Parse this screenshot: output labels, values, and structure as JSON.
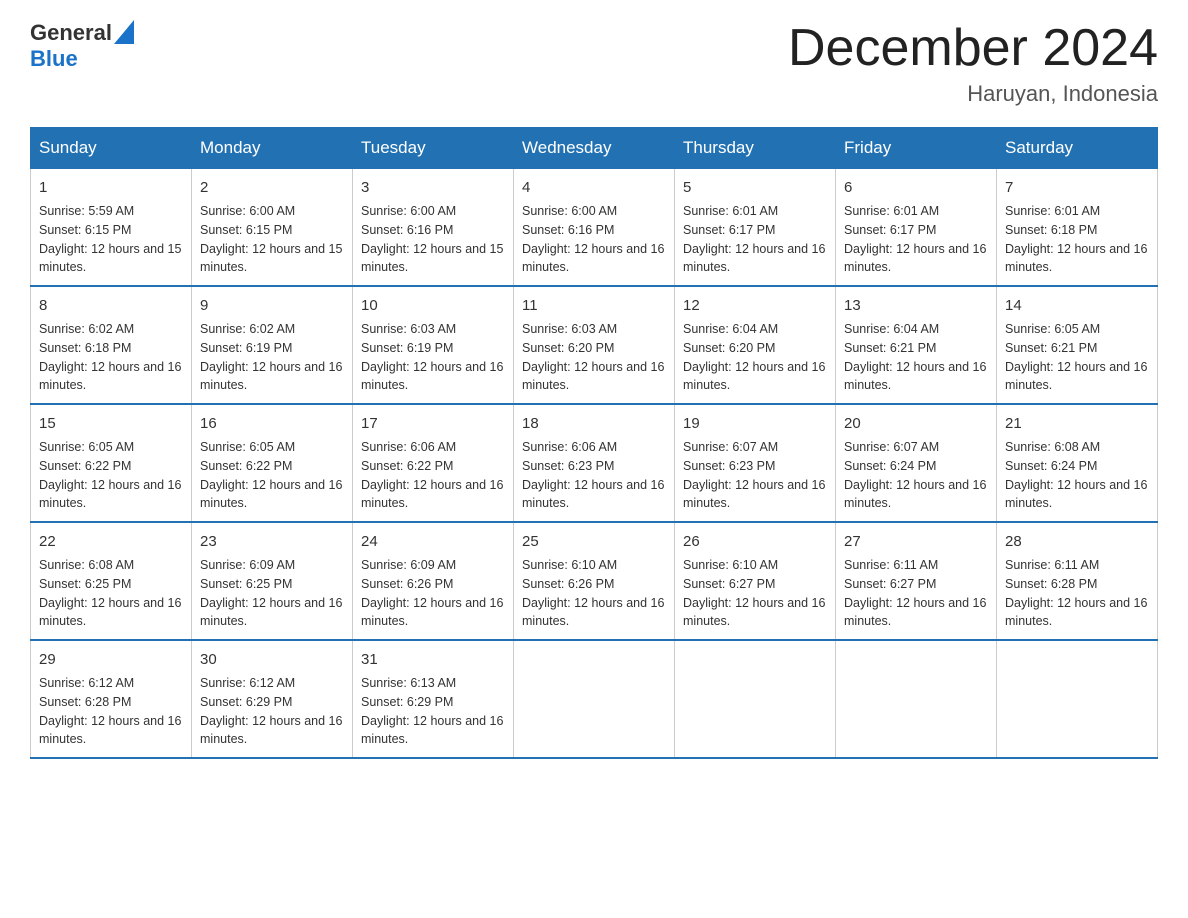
{
  "header": {
    "logo_general": "General",
    "logo_blue": "Blue",
    "title": "December 2024",
    "subtitle": "Haruyan, Indonesia"
  },
  "days_of_week": [
    "Sunday",
    "Monday",
    "Tuesday",
    "Wednesday",
    "Thursday",
    "Friday",
    "Saturday"
  ],
  "weeks": [
    [
      {
        "day": "1",
        "sunrise": "5:59 AM",
        "sunset": "6:15 PM",
        "daylight": "12 hours and 15 minutes."
      },
      {
        "day": "2",
        "sunrise": "6:00 AM",
        "sunset": "6:15 PM",
        "daylight": "12 hours and 15 minutes."
      },
      {
        "day": "3",
        "sunrise": "6:00 AM",
        "sunset": "6:16 PM",
        "daylight": "12 hours and 15 minutes."
      },
      {
        "day": "4",
        "sunrise": "6:00 AM",
        "sunset": "6:16 PM",
        "daylight": "12 hours and 16 minutes."
      },
      {
        "day": "5",
        "sunrise": "6:01 AM",
        "sunset": "6:17 PM",
        "daylight": "12 hours and 16 minutes."
      },
      {
        "day": "6",
        "sunrise": "6:01 AM",
        "sunset": "6:17 PM",
        "daylight": "12 hours and 16 minutes."
      },
      {
        "day": "7",
        "sunrise": "6:01 AM",
        "sunset": "6:18 PM",
        "daylight": "12 hours and 16 minutes."
      }
    ],
    [
      {
        "day": "8",
        "sunrise": "6:02 AM",
        "sunset": "6:18 PM",
        "daylight": "12 hours and 16 minutes."
      },
      {
        "day": "9",
        "sunrise": "6:02 AM",
        "sunset": "6:19 PM",
        "daylight": "12 hours and 16 minutes."
      },
      {
        "day": "10",
        "sunrise": "6:03 AM",
        "sunset": "6:19 PM",
        "daylight": "12 hours and 16 minutes."
      },
      {
        "day": "11",
        "sunrise": "6:03 AM",
        "sunset": "6:20 PM",
        "daylight": "12 hours and 16 minutes."
      },
      {
        "day": "12",
        "sunrise": "6:04 AM",
        "sunset": "6:20 PM",
        "daylight": "12 hours and 16 minutes."
      },
      {
        "day": "13",
        "sunrise": "6:04 AM",
        "sunset": "6:21 PM",
        "daylight": "12 hours and 16 minutes."
      },
      {
        "day": "14",
        "sunrise": "6:05 AM",
        "sunset": "6:21 PM",
        "daylight": "12 hours and 16 minutes."
      }
    ],
    [
      {
        "day": "15",
        "sunrise": "6:05 AM",
        "sunset": "6:22 PM",
        "daylight": "12 hours and 16 minutes."
      },
      {
        "day": "16",
        "sunrise": "6:05 AM",
        "sunset": "6:22 PM",
        "daylight": "12 hours and 16 minutes."
      },
      {
        "day": "17",
        "sunrise": "6:06 AM",
        "sunset": "6:22 PM",
        "daylight": "12 hours and 16 minutes."
      },
      {
        "day": "18",
        "sunrise": "6:06 AM",
        "sunset": "6:23 PM",
        "daylight": "12 hours and 16 minutes."
      },
      {
        "day": "19",
        "sunrise": "6:07 AM",
        "sunset": "6:23 PM",
        "daylight": "12 hours and 16 minutes."
      },
      {
        "day": "20",
        "sunrise": "6:07 AM",
        "sunset": "6:24 PM",
        "daylight": "12 hours and 16 minutes."
      },
      {
        "day": "21",
        "sunrise": "6:08 AM",
        "sunset": "6:24 PM",
        "daylight": "12 hours and 16 minutes."
      }
    ],
    [
      {
        "day": "22",
        "sunrise": "6:08 AM",
        "sunset": "6:25 PM",
        "daylight": "12 hours and 16 minutes."
      },
      {
        "day": "23",
        "sunrise": "6:09 AM",
        "sunset": "6:25 PM",
        "daylight": "12 hours and 16 minutes."
      },
      {
        "day": "24",
        "sunrise": "6:09 AM",
        "sunset": "6:26 PM",
        "daylight": "12 hours and 16 minutes."
      },
      {
        "day": "25",
        "sunrise": "6:10 AM",
        "sunset": "6:26 PM",
        "daylight": "12 hours and 16 minutes."
      },
      {
        "day": "26",
        "sunrise": "6:10 AM",
        "sunset": "6:27 PM",
        "daylight": "12 hours and 16 minutes."
      },
      {
        "day": "27",
        "sunrise": "6:11 AM",
        "sunset": "6:27 PM",
        "daylight": "12 hours and 16 minutes."
      },
      {
        "day": "28",
        "sunrise": "6:11 AM",
        "sunset": "6:28 PM",
        "daylight": "12 hours and 16 minutes."
      }
    ],
    [
      {
        "day": "29",
        "sunrise": "6:12 AM",
        "sunset": "6:28 PM",
        "daylight": "12 hours and 16 minutes."
      },
      {
        "day": "30",
        "sunrise": "6:12 AM",
        "sunset": "6:29 PM",
        "daylight": "12 hours and 16 minutes."
      },
      {
        "day": "31",
        "sunrise": "6:13 AM",
        "sunset": "6:29 PM",
        "daylight": "12 hours and 16 minutes."
      },
      null,
      null,
      null,
      null
    ]
  ]
}
